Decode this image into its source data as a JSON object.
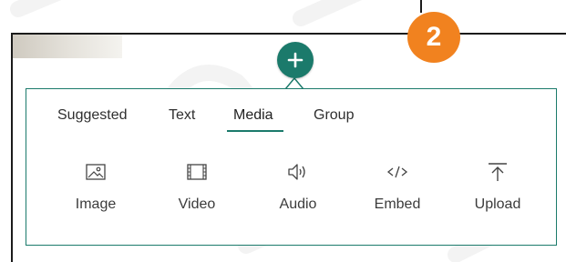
{
  "step_badge": {
    "number": "2",
    "color": "#f1821f"
  },
  "add_button": {
    "symbol": "+",
    "color": "#1b7a6b"
  },
  "toolbox": {
    "accent_color": "#1b7a6b",
    "tabs": [
      {
        "label": "Suggested",
        "active": false
      },
      {
        "label": "Text",
        "active": false
      },
      {
        "label": "Media",
        "active": true
      },
      {
        "label": "Group",
        "active": false
      }
    ],
    "tiles": [
      {
        "label": "Image",
        "icon": "image-icon"
      },
      {
        "label": "Video",
        "icon": "video-icon"
      },
      {
        "label": "Audio",
        "icon": "audio-icon"
      },
      {
        "label": "Embed",
        "icon": "embed-icon"
      },
      {
        "label": "Upload",
        "icon": "upload-icon"
      }
    ]
  }
}
